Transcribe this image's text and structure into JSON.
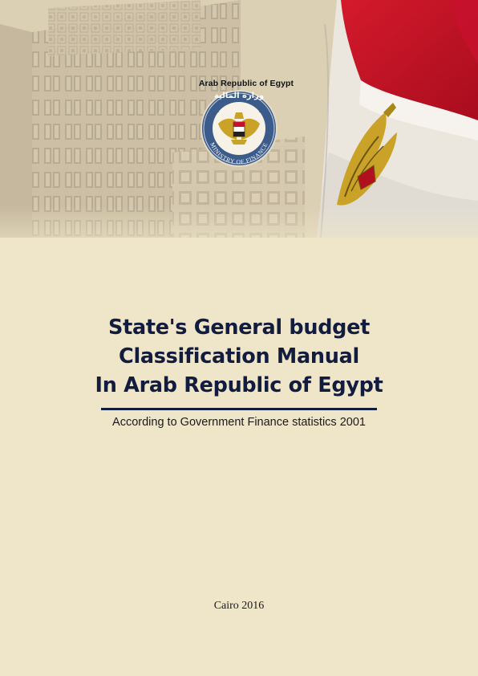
{
  "cover": {
    "country_label": "Arab Republic of Egypt",
    "seal": {
      "arabic_text": "وزارة المالية",
      "english_text": "MINISTRY OF FINANCE"
    },
    "title_lines": [
      "State's General budget",
      "Classification Manual",
      "In Arab Republic of Egypt"
    ],
    "subtitle": "According to Government Finance statistics 2001",
    "imprint": "Cairo 2016"
  },
  "colors": {
    "background": "#efe5c8",
    "title_navy": "#121c3f",
    "flag_red": "#c8102e",
    "flag_white": "#f4f2ee",
    "eagle_gold": "#c9a227"
  },
  "icons": [
    "building-facade-image",
    "egyptian-flag-image",
    "ministry-seal-icon",
    "eagle-emblem-icon"
  ]
}
